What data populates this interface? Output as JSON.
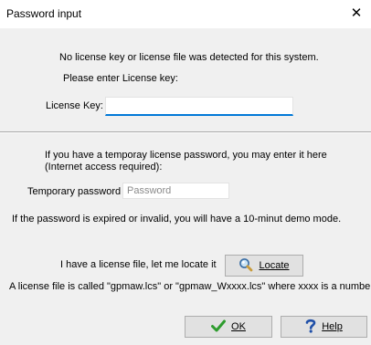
{
  "window": {
    "title": "Password input",
    "close_glyph": "✕"
  },
  "messages": {
    "no_license": "No license key or license file was detected for this system.",
    "please_enter": "Please enter License key:"
  },
  "license_key": {
    "label": "License Key:",
    "value": ""
  },
  "temporary": {
    "info_line1": "If you have a temporay license password, you may enter it here",
    "info_line2": "(Internet access required):",
    "label": "Temporary password",
    "placeholder": "Password",
    "value": "",
    "demo_note": "If the password is expired or invalid, you will have a 10-minut demo mode."
  },
  "license_file": {
    "prompt": "I have a license file, let me locate it",
    "locate_label": "Locate",
    "locate_icon": "magnifier-icon",
    "note": "A license file is called \"gpmaw.lcs\" or \"gpmaw_Wxxxx.lcs\" where xxxx is a number."
  },
  "buttons": {
    "ok_label": "OK",
    "ok_icon": "checkmark-icon",
    "help_label": "Help",
    "help_icon": "question-mark-icon"
  },
  "colors": {
    "focus_underline": "#0078d7",
    "checkmark": "#2e9c2e",
    "question": "#1f4fa8"
  }
}
